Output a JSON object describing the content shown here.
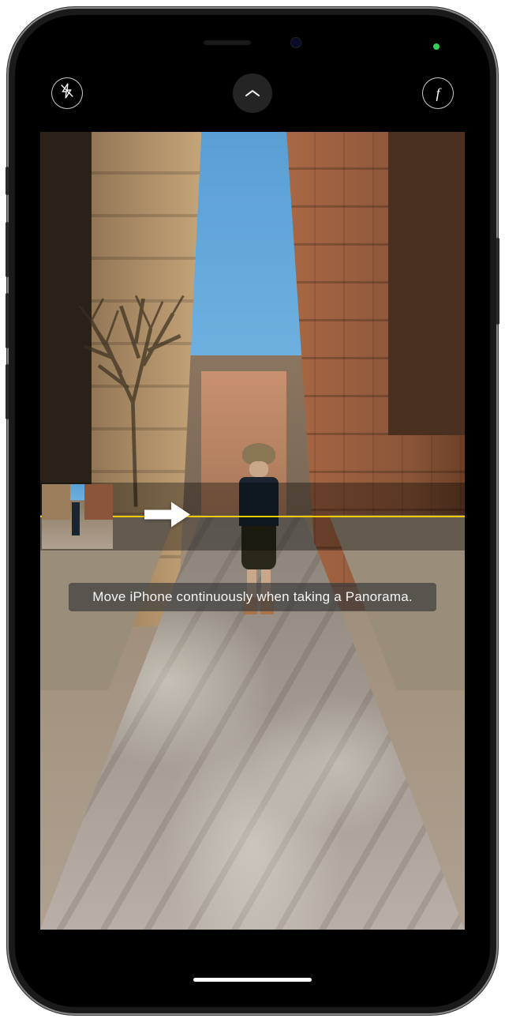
{
  "camera": {
    "mode": "Panorama",
    "instruction": "Move iPhone continuously when taking a Panorama.",
    "flash_state": "off",
    "guideline_color": "#ffcc00",
    "arrow_direction": "right"
  },
  "top_controls": {
    "flash_label": "Flash Off",
    "expand_label": "Camera Controls",
    "options_label": "Depth Options"
  },
  "status": {
    "camera_active": true,
    "indicator_color": "#30d158"
  }
}
